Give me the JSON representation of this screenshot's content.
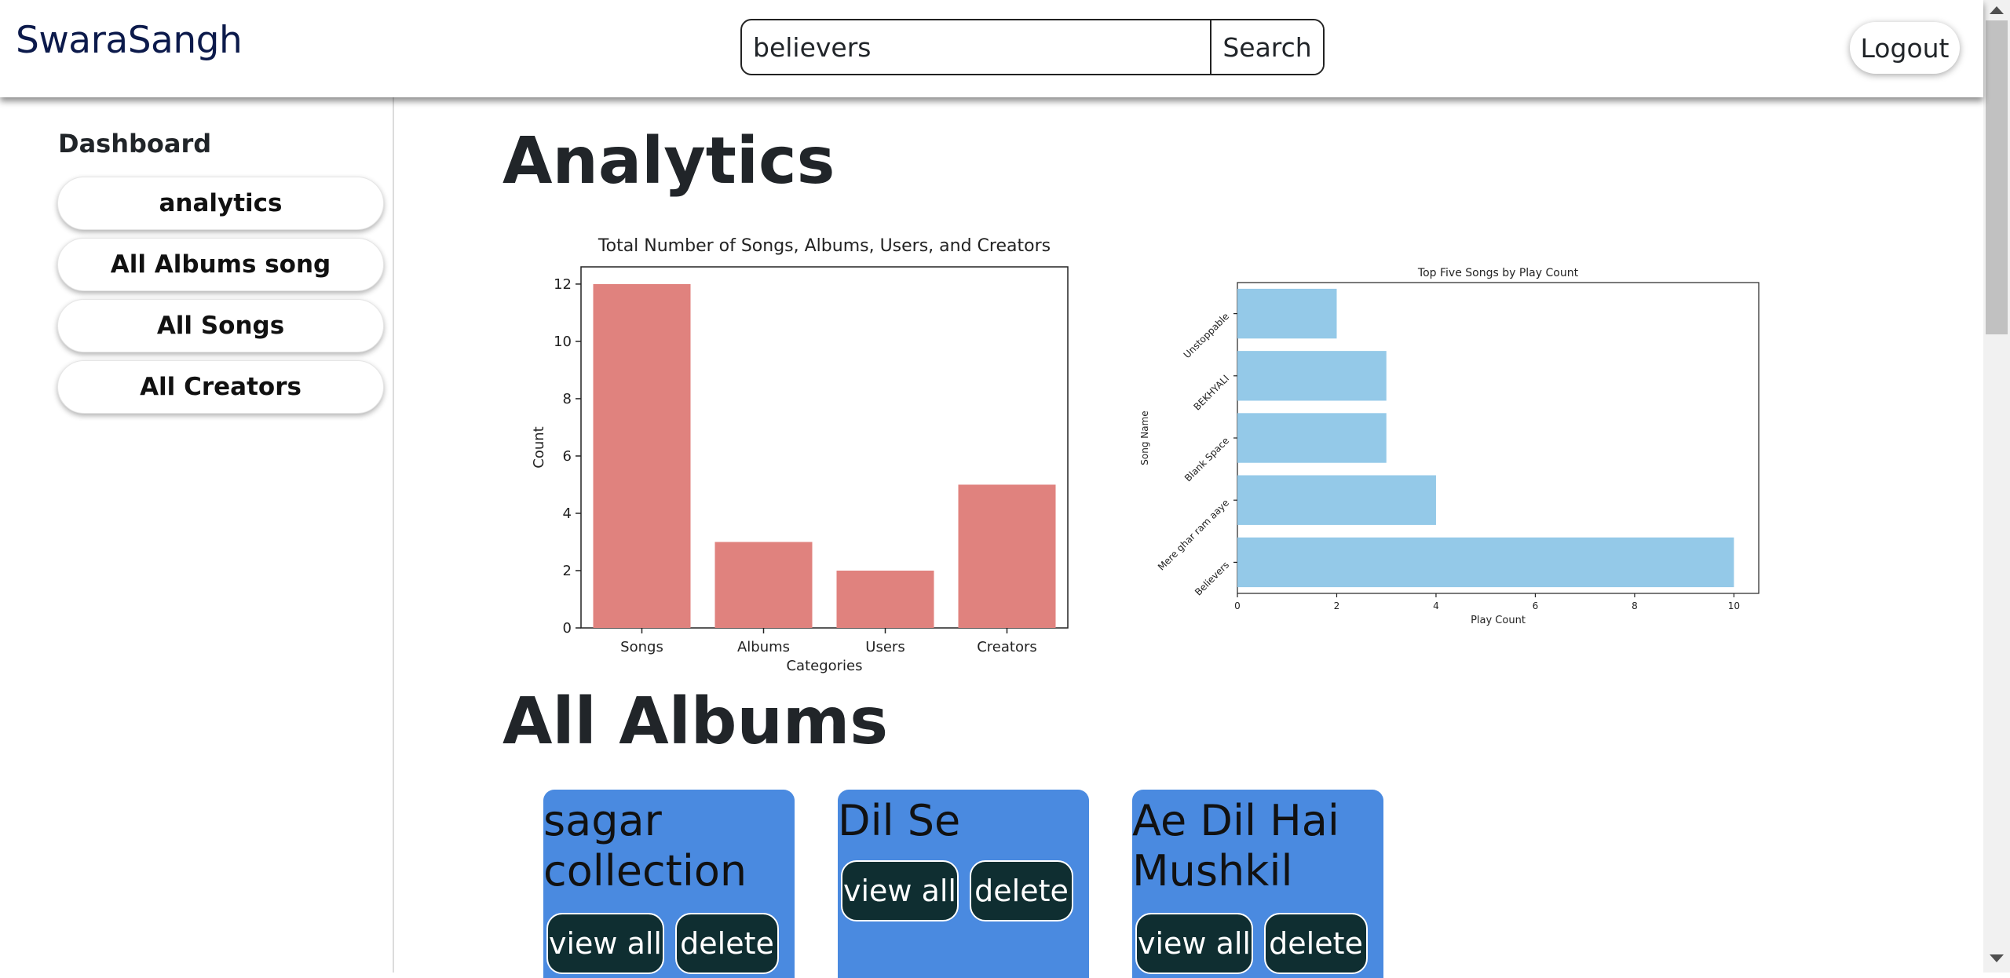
{
  "header": {
    "brand": "SwaraSangh",
    "search_value": "believers",
    "search_button": "Search",
    "logout_label": "Logout"
  },
  "sidebar": {
    "title": "Dashboard",
    "items": [
      {
        "label": "analytics"
      },
      {
        "label": "All Albums song"
      },
      {
        "label": "All Songs"
      },
      {
        "label": "All Creators"
      }
    ]
  },
  "main": {
    "analytics_heading": "Analytics",
    "albums_heading": "All Albums",
    "albums": [
      {
        "name": " sagar collection",
        "view_label": "view all",
        "delete_label": "delete"
      },
      {
        "name": " Dil Se",
        "view_label": "view all",
        "delete_label": "delete"
      },
      {
        "name": " Ae Dil Hai Mushkil",
        "view_label": "view all",
        "delete_label": "delete"
      }
    ]
  },
  "chart_data": [
    {
      "type": "bar",
      "title": "Total Number of Songs, Albums, Users, and Creators",
      "xlabel": "Categories",
      "ylabel": "Count",
      "categories": [
        "Songs",
        "Albums",
        "Users",
        "Creators"
      ],
      "values": [
        12,
        3,
        2,
        5
      ],
      "ylim": [
        0,
        12.6
      ],
      "yticks": [
        0,
        2,
        4,
        6,
        8,
        10,
        12
      ],
      "color": "#e0827e",
      "grid": false
    },
    {
      "type": "bar",
      "orientation": "horizontal",
      "title": "Top Five Songs by Play Count",
      "xlabel": "Play Count",
      "ylabel": "Song Name",
      "categories": [
        "Believers",
        "Mere ghar ram aaye",
        "Blank Space",
        "BEKHYALI",
        "Unstoppable"
      ],
      "values": [
        10,
        4,
        3,
        3,
        2
      ],
      "xlim": [
        0,
        10.5
      ],
      "xticks": [
        0,
        2,
        4,
        6,
        8,
        10
      ],
      "color": "#94c9e8",
      "grid": false
    }
  ]
}
